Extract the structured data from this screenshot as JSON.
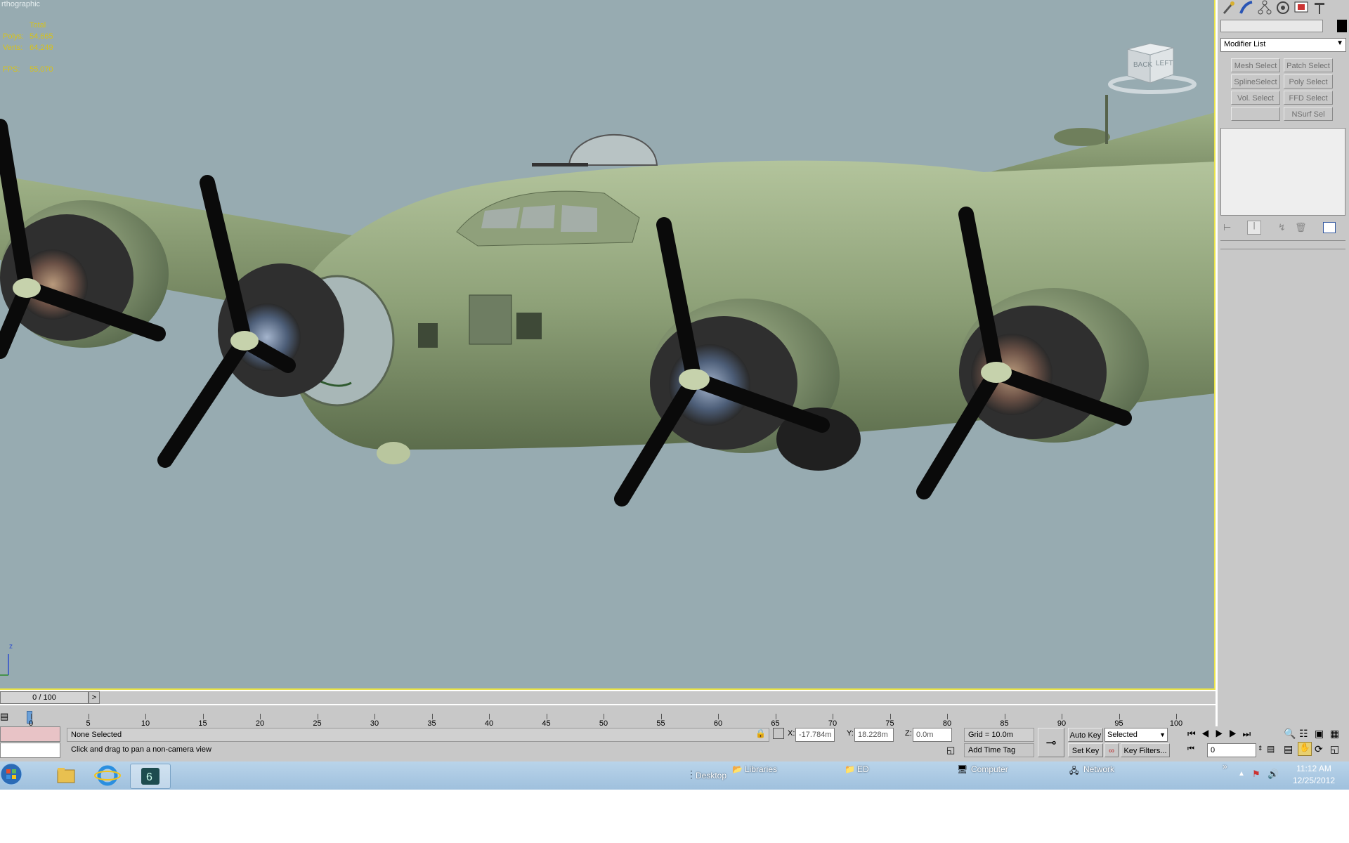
{
  "viewport": {
    "label": "rthographic",
    "stats": {
      "header": "Total",
      "polys_label": "Polys:",
      "polys_value": "54,665",
      "verts_label": "Verts:",
      "verts_value": "64,249",
      "fps_label": "FPS:",
      "fps_value": "55,070"
    },
    "viewcube": {
      "face_back": "BACK",
      "face_left": "LEFT"
    },
    "axis_label": "z"
  },
  "command_panel": {
    "tabs": [
      "create-icon",
      "modify-icon",
      "hierarchy-icon",
      "motion-icon",
      "display-icon",
      "utilities-icon"
    ],
    "modifier_list": "Modifier List",
    "modifier_buttons": [
      {
        "label": "Mesh Select"
      },
      {
        "label": "Patch Select"
      },
      {
        "label": "SplineSelect"
      },
      {
        "label": "Poly Select"
      },
      {
        "label": "Vol. Select"
      },
      {
        "label": "FFD Select"
      },
      {
        "label": ""
      },
      {
        "label": "NSurf Sel"
      }
    ],
    "stack_tools": [
      "pin-stack-icon",
      "show-end-result-icon",
      "make-unique-icon",
      "remove-modifier-icon",
      "configure-sets-icon"
    ]
  },
  "timeline": {
    "frame_display": "0 / 100",
    "next_label": ">",
    "ticks": [
      "0",
      "5",
      "10",
      "15",
      "20",
      "25",
      "30",
      "35",
      "40",
      "45",
      "50",
      "55",
      "60",
      "65",
      "70",
      "75",
      "80",
      "85",
      "90",
      "95",
      "100"
    ]
  },
  "status": {
    "selection": "None Selected",
    "prompt": "Click and drag to pan a non-camera view",
    "x_label": "X:",
    "x_value": "-17.784m",
    "y_label": "Y:",
    "y_value": "18.228m",
    "z_label": "Z:",
    "z_value": "0.0m",
    "grid": "Grid = 10.0m",
    "add_time_tag": "Add Time Tag",
    "auto_key": "Auto Key",
    "set_key": "Set Key",
    "key_mode": "Selected",
    "key_filters": "Key Filters...",
    "current_frame": "0"
  },
  "taskbar": {
    "desktop": "Desktop",
    "libraries": "Libraries",
    "ed": "ED",
    "computer": "Computer",
    "network": "Network",
    "overflow": "»",
    "time": "11:12 AM",
    "date": "12/25/2012"
  }
}
